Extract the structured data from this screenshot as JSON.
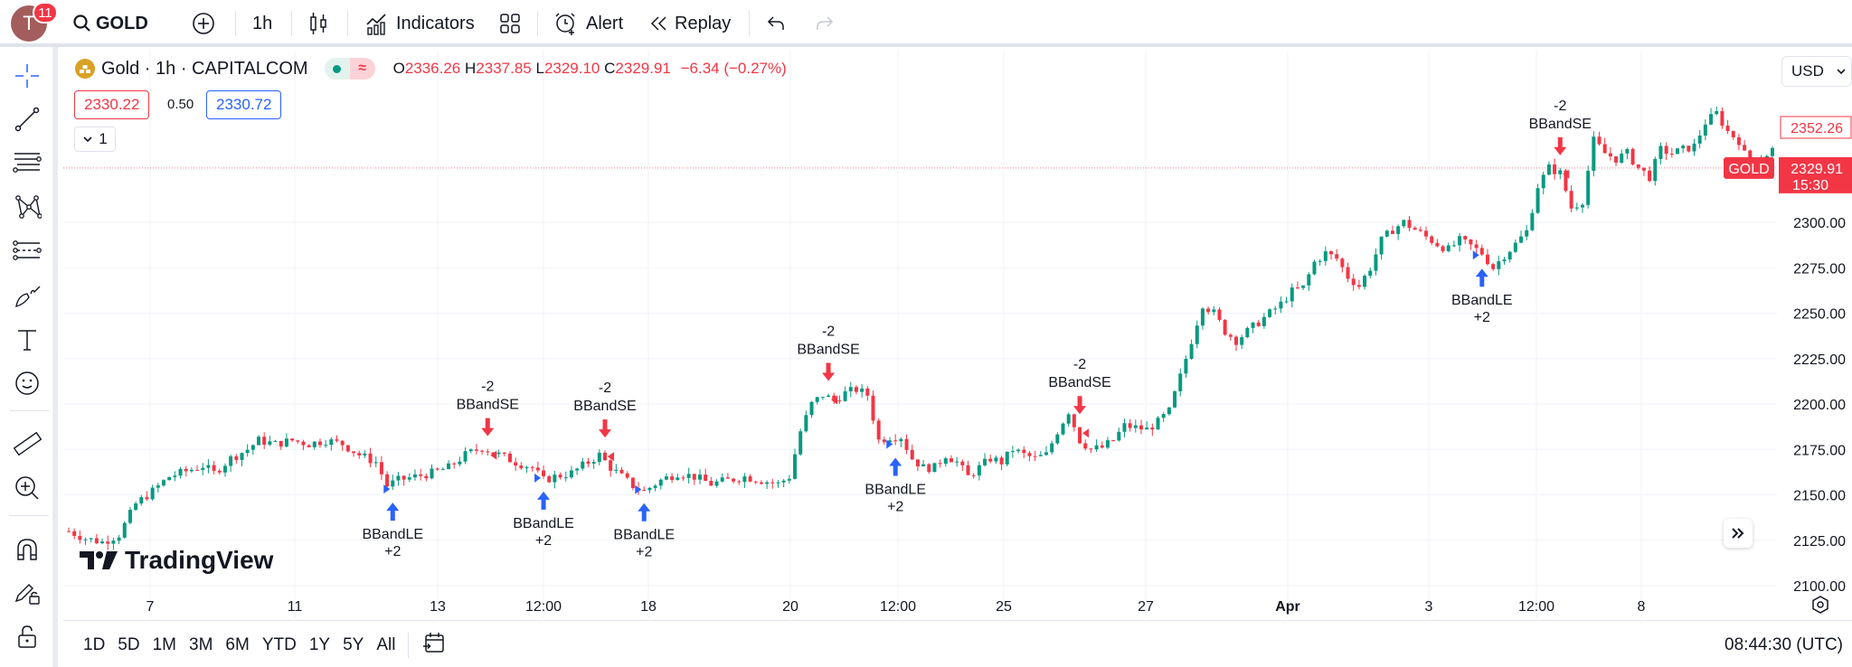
{
  "user": {
    "avatar_letter": "T",
    "notifications": "11"
  },
  "toolbar": {
    "symbol": "GOLD",
    "interval": "1h",
    "indicators": "Indicators",
    "alert": "Alert",
    "replay": "Replay"
  },
  "legend": {
    "name": "Gold · 1h · CAPITALCOM",
    "o_label": "O",
    "o": "2336.26",
    "h_label": "H",
    "h": "2337.85",
    "l_label": "L",
    "l": "2329.10",
    "c_label": "C",
    "c": "2329.91",
    "change": "−6.34 (−0.27%)",
    "bid": "2330.22",
    "spread": "0.50",
    "ask": "2330.72",
    "collapse": "1"
  },
  "price_axis": {
    "currency": "USD",
    "ticks": [
      "2300.00",
      "2275.00",
      "2250.00",
      "2225.00",
      "2200.00",
      "2175.00",
      "2150.00",
      "2125.00",
      "2100.00"
    ],
    "high_label": "2352.26",
    "last_price": "2329.91",
    "countdown": "15:30",
    "symbol_tag": "GOLD"
  },
  "time_axis": {
    "ticks": [
      {
        "label": "7",
        "bold": false
      },
      {
        "label": "11",
        "bold": false
      },
      {
        "label": "13",
        "bold": false
      },
      {
        "label": "12:00",
        "bold": false
      },
      {
        "label": "18",
        "bold": false
      },
      {
        "label": "20",
        "bold": false
      },
      {
        "label": "12:00",
        "bold": false
      },
      {
        "label": "25",
        "bold": false
      },
      {
        "label": "27",
        "bold": false
      },
      {
        "label": "Apr",
        "bold": true
      },
      {
        "label": "3",
        "bold": false
      },
      {
        "label": "12:00",
        "bold": false
      },
      {
        "label": "8",
        "bold": false
      }
    ]
  },
  "bottom": {
    "ranges": [
      "1D",
      "5D",
      "1M",
      "3M",
      "6M",
      "YTD",
      "1Y",
      "5Y",
      "All"
    ],
    "clock": "08:44:30 (UTC)"
  },
  "watermark": "TradingView",
  "colors": {
    "up": "#089981",
    "down": "#f23645",
    "long_signal": "#2962ff",
    "short_signal": "#f23645"
  },
  "chart_data": {
    "type": "candlestick",
    "title": "Gold · 1h · CAPITALCOM",
    "ylim": [
      2095,
      2399
    ],
    "yticks": [
      2100,
      2125,
      2150,
      2175,
      2200,
      2225,
      2250,
      2275,
      2300
    ],
    "xticks": [
      "7",
      "11",
      "13",
      "12:00",
      "18",
      "20",
      "12:00",
      "25",
      "27",
      "Apr",
      "3",
      "12:00",
      "8"
    ],
    "price_path": [
      [
        0,
        2130
      ],
      [
        3,
        2126
      ],
      [
        6,
        2124
      ],
      [
        9,
        2128
      ],
      [
        12,
        2145
      ],
      [
        15,
        2152
      ],
      [
        18,
        2160
      ],
      [
        21,
        2163
      ],
      [
        24,
        2166
      ],
      [
        26,
        2162
      ],
      [
        29,
        2170
      ],
      [
        32,
        2175
      ],
      [
        34,
        2180
      ],
      [
        37,
        2178
      ],
      [
        40,
        2180
      ],
      [
        43,
        2178
      ],
      [
        46,
        2180
      ],
      [
        49,
        2178
      ],
      [
        52,
        2172
      ],
      [
        55,
        2168
      ],
      [
        57,
        2155
      ],
      [
        59,
        2158
      ],
      [
        62,
        2160
      ],
      [
        65,
        2162
      ],
      [
        68,
        2165
      ],
      [
        71,
        2172
      ],
      [
        74,
        2176
      ],
      [
        77,
        2172
      ],
      [
        80,
        2168
      ],
      [
        83,
        2165
      ],
      [
        85,
        2158
      ],
      [
        87,
        2160
      ],
      [
        90,
        2162
      ],
      [
        93,
        2168
      ],
      [
        95,
        2172
      ],
      [
        97,
        2165
      ],
      [
        99,
        2160
      ],
      [
        101,
        2155
      ],
      [
        103,
        2152
      ],
      [
        106,
        2158
      ],
      [
        109,
        2162
      ],
      [
        112,
        2160
      ],
      [
        115,
        2156
      ],
      [
        118,
        2158
      ],
      [
        121,
        2160
      ],
      [
        124,
        2158
      ],
      [
        127,
        2156
      ],
      [
        129,
        2160
      ],
      [
        131,
        2185
      ],
      [
        133,
        2200
      ],
      [
        135,
        2205
      ],
      [
        137,
        2202
      ],
      [
        139,
        2206
      ],
      [
        141,
        2208
      ],
      [
        143,
        2205
      ],
      [
        145,
        2180
      ],
      [
        147,
        2182
      ],
      [
        149,
        2182
      ],
      [
        151,
        2170
      ],
      [
        153,
        2165
      ],
      [
        155,
        2165
      ],
      [
        157,
        2172
      ],
      [
        159,
        2168
      ],
      [
        161,
        2160
      ],
      [
        163,
        2165
      ],
      [
        165,
        2170
      ],
      [
        167,
        2168
      ],
      [
        169,
        2175
      ],
      [
        171,
        2172
      ],
      [
        173,
        2170
      ],
      [
        175,
        2172
      ],
      [
        177,
        2185
      ],
      [
        179,
        2196
      ],
      [
        181,
        2180
      ],
      [
        183,
        2175
      ],
      [
        185,
        2176
      ],
      [
        187,
        2180
      ],
      [
        189,
        2188
      ],
      [
        191,
        2187
      ],
      [
        193,
        2186
      ],
      [
        195,
        2190
      ],
      [
        197,
        2196
      ],
      [
        199,
        2215
      ],
      [
        201,
        2235
      ],
      [
        203,
        2255
      ],
      [
        205,
        2250
      ],
      [
        207,
        2240
      ],
      [
        209,
        2235
      ],
      [
        211,
        2240
      ],
      [
        213,
        2245
      ],
      [
        215,
        2250
      ],
      [
        217,
        2255
      ],
      [
        219,
        2262
      ],
      [
        221,
        2264
      ],
      [
        223,
        2278
      ],
      [
        225,
        2283
      ],
      [
        227,
        2280
      ],
      [
        229,
        2270
      ],
      [
        231,
        2265
      ],
      [
        233,
        2275
      ],
      [
        235,
        2290
      ],
      [
        237,
        2296
      ],
      [
        239,
        2300
      ],
      [
        241,
        2296
      ],
      [
        243,
        2292
      ],
      [
        245,
        2288
      ],
      [
        247,
        2285
      ],
      [
        249,
        2290
      ],
      [
        251,
        2287
      ],
      [
        253,
        2283
      ],
      [
        255,
        2275
      ],
      [
        257,
        2282
      ],
      [
        259,
        2288
      ],
      [
        261,
        2295
      ],
      [
        263,
        2320
      ],
      [
        265,
        2330
      ],
      [
        267,
        2327
      ],
      [
        269,
        2308
      ],
      [
        271,
        2312
      ],
      [
        273,
        2345
      ],
      [
        275,
        2338
      ],
      [
        277,
        2335
      ],
      [
        279,
        2338
      ],
      [
        281,
        2330
      ],
      [
        283,
        2325
      ],
      [
        285,
        2340
      ],
      [
        287,
        2338
      ],
      [
        289,
        2340
      ],
      [
        291,
        2342
      ],
      [
        293,
        2355
      ],
      [
        295,
        2360
      ],
      [
        297,
        2350
      ],
      [
        299,
        2345
      ],
      [
        301,
        2330
      ],
      [
        303,
        2335
      ],
      [
        305,
        2340
      ]
    ],
    "signals": [
      {
        "type": "long",
        "index": 58,
        "label": "BBandLE",
        "qty": "+2"
      },
      {
        "type": "short",
        "index": 75,
        "label": "BBandSE",
        "qty": "-2"
      },
      {
        "type": "long",
        "index": 85,
        "label": "BBandLE",
        "qty": "+2"
      },
      {
        "type": "short",
        "index": 96,
        "label": "BBandSE",
        "qty": "-2"
      },
      {
        "type": "long",
        "index": 103,
        "label": "BBandLE",
        "qty": "+2"
      },
      {
        "type": "short",
        "index": 136,
        "label": "BBandSE",
        "qty": "-2"
      },
      {
        "type": "long",
        "index": 148,
        "label": "BBandLE",
        "qty": "+2"
      },
      {
        "type": "short",
        "index": 181,
        "label": "BBandSE",
        "qty": "-2"
      },
      {
        "type": "long",
        "index": 253,
        "label": "BBandLE",
        "qty": "+2"
      },
      {
        "type": "short",
        "index": 267,
        "label": "BBandSE",
        "qty": "-2"
      }
    ],
    "last_price": 2329.91,
    "high_marker": 2352.26
  }
}
